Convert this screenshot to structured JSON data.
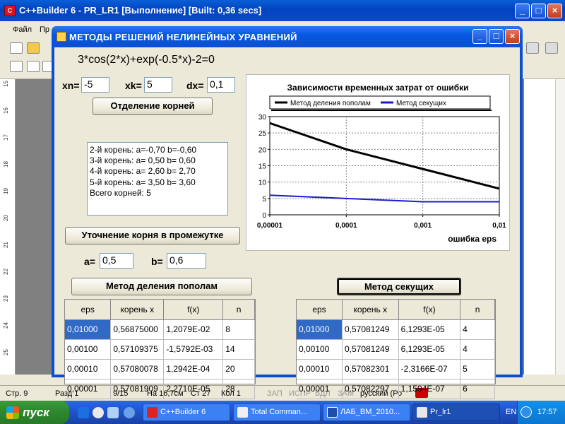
{
  "ide": {
    "title": "C++Builder 6 - PR_LR1 [Выполнение] [Built: 0,36 secs]",
    "menu": [
      "Файл",
      "Пр"
    ],
    "ruler_marks": [
      "15",
      "16",
      "17",
      "18",
      "19",
      "20",
      "21",
      "22",
      "23",
      "24",
      "25"
    ],
    "status": {
      "page": "Стр. 9",
      "section": "Разд 1",
      "pages": "9/15",
      "position": "На 16,7см",
      "line": "Ст 27",
      "column": "Кол 1",
      "rec": "ЗАП",
      "trk": "ИСПР",
      "ext": "ВДЛ",
      "ovr": "ЗАМ",
      "language": "русский (Ро"
    }
  },
  "dialog": {
    "title": "МЕТОДЫ  РЕШЕНИЙ  НЕЛИНЕЙНЫХ  УРАВНЕНИЙ",
    "equation": "3*cos(2*x)+exp(-0.5*x)-2=0",
    "xn_label": "xn=",
    "xn_value": "-5",
    "xk_label": "xk=",
    "xk_value": "5",
    "dx_label": "dx=",
    "dx_value": "0,1",
    "separate_button": "Отделение корней",
    "roots_memo": [
      "2-й корень:  a=-0,70  b=-0,60",
      "3-й корень:  a= 0,50  b= 0,60",
      "4-й корень:  a= 2,60  b= 2,70",
      "5-й корень:  a= 3,50  b= 3,60",
      "Всего корней: 5"
    ],
    "refine_button": "Уточнение корня в промежутке",
    "a_label": "a=",
    "a_value": "0,5",
    "b_label": "b=",
    "b_value": "0,6",
    "bisection_button": "Метод деления пополам",
    "secant_button": "Метод секущих",
    "table_headers": [
      "eps",
      "корень x",
      "f(x)",
      "n"
    ],
    "bisection_rows": [
      [
        "0,01000",
        "0,56875000",
        "1,2079E-02",
        "8"
      ],
      [
        "0,00100",
        "0,57109375",
        "-1,5792E-03",
        "14"
      ],
      [
        "0,00010",
        "0,57080078",
        "1,2942E-04",
        "20"
      ],
      [
        "0,00001",
        "0,57081909",
        "2,2710E-05",
        "28"
      ]
    ],
    "secant_rows": [
      [
        "0,01000",
        "0,57081249",
        "6,1293E-05",
        "4"
      ],
      [
        "0,00100",
        "0,57081249",
        "6,1293E-05",
        "4"
      ],
      [
        "0,00010",
        "0,57082301",
        "-2,3166E-07",
        "5"
      ],
      [
        "0,00001",
        "0,57082297",
        "1,1594E-07",
        "6"
      ]
    ]
  },
  "chart_data": {
    "type": "line",
    "title": "Зависимости временных затрат от ошибки",
    "xlabel": "ошибка eps",
    "ylabel": "",
    "x_ticks": [
      "0,00001",
      "0,0001",
      "0,001",
      "0,01"
    ],
    "x": [
      1e-05,
      0.0001,
      0.001,
      0.01
    ],
    "x_scale": "log",
    "ylim": [
      0,
      30
    ],
    "y_ticks": [
      0,
      5,
      10,
      15,
      20,
      25,
      30
    ],
    "grid": true,
    "legend": "top",
    "series": [
      {
        "name": "Метод деления пополам",
        "color": "#000000",
        "values": [
          28,
          20,
          14,
          8
        ]
      },
      {
        "name": "Метод секущих",
        "color": "#1a1ad0",
        "values": [
          6,
          5,
          4,
          4
        ]
      }
    ]
  },
  "taskbar": {
    "start": "пуск",
    "tasks": [
      "C++Builder 6",
      "Total Comman...",
      "ЛАБ_ВМ_2010...",
      "Pr_lr1"
    ],
    "lang": "EN",
    "clock": "17:57"
  }
}
